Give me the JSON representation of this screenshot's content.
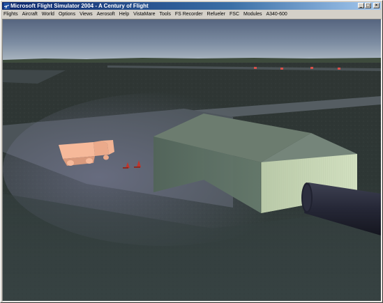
{
  "window": {
    "title": "Microsoft Flight Simulator 2004 - A Century of Flight",
    "minimize_glyph": "_",
    "maximize_glyph": "□",
    "close_glyph": "×"
  },
  "menu": [
    {
      "label": "Flights",
      "name": "menu-flights"
    },
    {
      "label": "Aircraft",
      "name": "menu-aircraft"
    },
    {
      "label": "World",
      "name": "menu-world"
    },
    {
      "label": "Options",
      "name": "menu-options"
    },
    {
      "label": "Views",
      "name": "menu-views"
    },
    {
      "label": "Aerosoft",
      "name": "menu-aerosoft"
    },
    {
      "label": "Help",
      "name": "menu-help"
    },
    {
      "label": "VistaMare",
      "name": "menu-vistamare"
    },
    {
      "label": "Tools",
      "name": "menu-tools"
    },
    {
      "label": "FS Recorder",
      "name": "menu-fs-recorder"
    },
    {
      "label": "Refueler",
      "name": "menu-refueler"
    },
    {
      "label": "FSC",
      "name": "menu-fsc"
    },
    {
      "label": "Modules",
      "name": "menu-modules"
    },
    {
      "label": "A340-600",
      "name": "menu-a340-600"
    }
  ],
  "scene": {
    "icons": [
      "app-icon",
      "fuel-truck",
      "hangar",
      "jetway-tube",
      "traffic-cones",
      "runway-lights"
    ],
    "colors": {
      "sky_top": "#5a6a85",
      "sky_horizon": "#9aa7b6",
      "grass": "#2d3533",
      "apron": "#4a5358",
      "hangar_side": "#c8d7b8",
      "hangar_front": "#5d6f62",
      "hangar_roof": "#6b7a70",
      "truck": "#f6b99a",
      "jetway": "#2a2c3a",
      "cone": "#c0362c"
    }
  }
}
